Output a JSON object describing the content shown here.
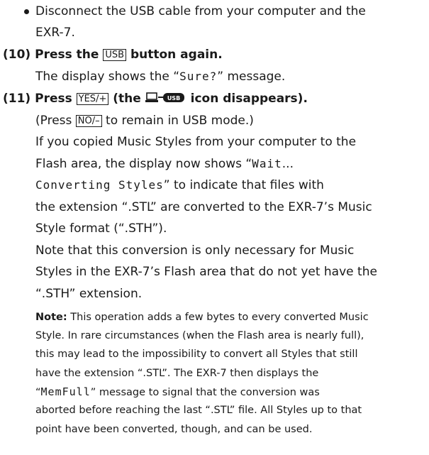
{
  "bullet_text": {
    "line1": "Disconnect the USB cable from your computer and the",
    "line2": "EXR-7."
  },
  "step10": {
    "number": "(10)",
    "pre": "Press the ",
    "button": "USB",
    "post": " button again.",
    "desc_pre": "The display shows the “",
    "lcd": "Sure?",
    "desc_post": "” message."
  },
  "step11": {
    "number": "(11)",
    "pre": "Press ",
    "button": "YES/+",
    "mid": " (the ",
    "icon_name": "pc-usb-icon",
    "post": " icon disappears).",
    "sub1_pre": "(Press ",
    "sub1_button": "NO/–",
    "sub1_post": " to remain in USB mode.)",
    "p1_l1": "If you copied Music Styles from your computer to the",
    "p1_l2_pre": "Flash area, the display now shows “",
    "p1_l2_lcd": "Wait",
    "p1_l2_post": "...",
    "p1_l3_lcd": "Converting Styles",
    "p1_l3_post": "” to indicate that files with",
    "p1_l4": "the extension “.STL” are converted to the EXR-7’s Music",
    "p1_l5": "Style format (“.STH”).",
    "p2_l1": "Note that this conversion is only necessary for Music",
    "p2_l2": "Styles in the EXR-7’s Flash area that do not yet have the",
    "p2_l3": "“.STH” extension."
  },
  "note": {
    "label": "Note:",
    "l1_post": " This operation adds a few bytes to every converted Music",
    "l2": "Style. In rare circumstances (when the Flash area is nearly full),",
    "l3": "this may lead to the impossibility to convert all Styles that still",
    "l4": "have the extension “.STL”. The EXR-7 then displays the",
    "l5_pre": "“",
    "l5_lcd": "MemFull",
    "l5_post": "” message to signal that the conversion was",
    "l6": "aborted before reaching the last “.STL” file. All Styles up to that",
    "l7": "point have been converted, though, and can be used."
  }
}
